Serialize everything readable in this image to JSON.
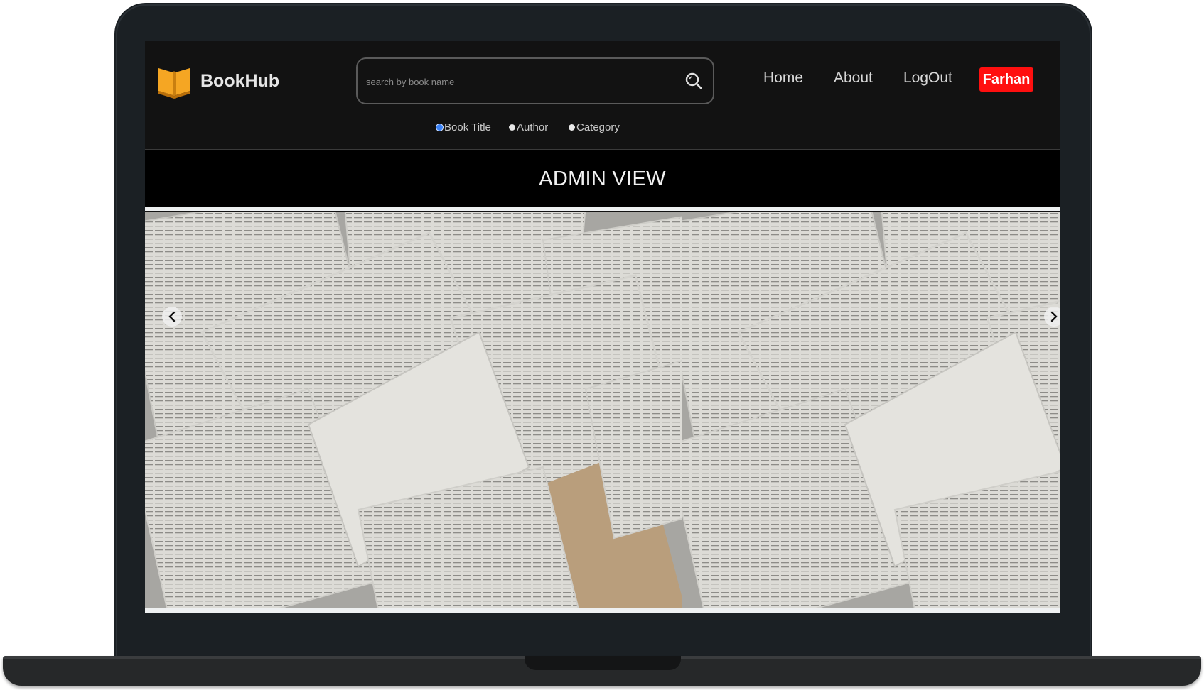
{
  "app": {
    "brand": "BookHub"
  },
  "search": {
    "placeholder": "search by book name",
    "value": ""
  },
  "filters": [
    {
      "label": "Book Title",
      "selected": true
    },
    {
      "label": "Author",
      "selected": false
    },
    {
      "label": "Category",
      "selected": false
    }
  ],
  "nav": {
    "home": "Home",
    "about": "About",
    "logout": "LogOut",
    "user": "Farhan"
  },
  "page": {
    "title": "ADMIN VIEW"
  },
  "carousel": {
    "prev_icon": "chevron-left-icon",
    "next_icon": "chevron-right-icon",
    "image": "open-books-pile"
  },
  "colors": {
    "accent": "#ff0f0f",
    "logo": "#f5a623",
    "navbar": "#121212",
    "header_bar": "#000000",
    "selected_radio": "#3b82f6"
  }
}
